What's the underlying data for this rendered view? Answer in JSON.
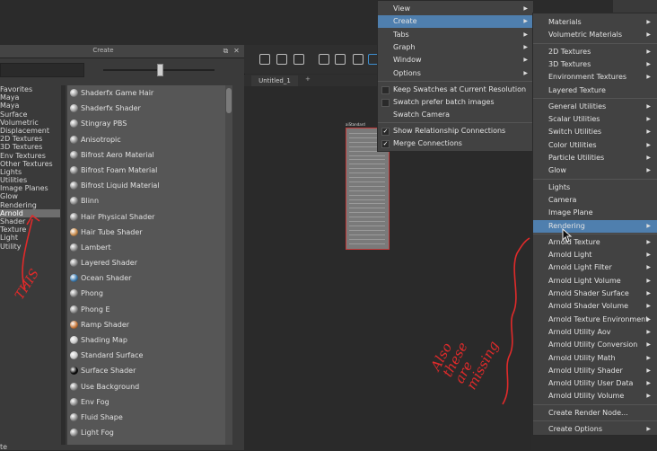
{
  "create_panel": {
    "title": "Create",
    "categories": [
      "Favorites",
      "Maya",
      "Maya",
      "Surface",
      "Volumetric",
      "Displacement",
      "2D Textures",
      "3D Textures",
      "Env Textures",
      "Other Textures",
      "Lights",
      "Utilities",
      "Image Planes",
      "Glow",
      "Rendering",
      "Arnold",
      "Shader",
      "Texture",
      "Light",
      "Utility"
    ],
    "selected_category": "Arnold",
    "nodes": [
      {
        "label": "Shaderfx Game Hair",
        "icon": "gray-sphere-icon",
        "color": "#9a9a9a"
      },
      {
        "label": "Shaderfx Shader",
        "icon": "gray-sphere-icon",
        "color": "#9a9a9a"
      },
      {
        "label": "Stingray PBS",
        "icon": "gray-sphere-icon",
        "color": "#9a9a9a"
      },
      {
        "label": "Anisotropic",
        "icon": "gray-sphere-icon",
        "color": "#8a8a8a"
      },
      {
        "label": "Bifrost Aero Material",
        "icon": "gray-sphere-icon",
        "color": "#8a8a8a"
      },
      {
        "label": "Bifrost Foam Material",
        "icon": "gray-sphere-icon",
        "color": "#8a8a8a"
      },
      {
        "label": "Bifrost Liquid Material",
        "icon": "gray-sphere-icon",
        "color": "#8a8a8a"
      },
      {
        "label": "Blinn",
        "icon": "gray-sphere-icon",
        "color": "#8a8a8a"
      },
      {
        "label": "Hair Physical Shader",
        "icon": "gray-sphere-icon",
        "color": "#8a8a8a"
      },
      {
        "label": "Hair Tube Shader",
        "icon": "hair-tube-icon",
        "color": "#c88a4a"
      },
      {
        "label": "Lambert",
        "icon": "gray-sphere-icon",
        "color": "#8a8a8a"
      },
      {
        "label": "Layered Shader",
        "icon": "gray-sphere-icon",
        "color": "#8a8a8a"
      },
      {
        "label": "Ocean Shader",
        "icon": "blue-sphere-icon",
        "color": "#3a7ab0"
      },
      {
        "label": "Phong",
        "icon": "gray-sphere-icon",
        "color": "#8a8a8a"
      },
      {
        "label": "Phong E",
        "icon": "gray-sphere-icon",
        "color": "#8a8a8a"
      },
      {
        "label": "Ramp Shader",
        "icon": "ramp-icon",
        "color": "#c8783a"
      },
      {
        "label": "Shading Map",
        "icon": "white-sphere-icon",
        "color": "#c8c8c8"
      },
      {
        "label": "Standard Surface",
        "icon": "white-sphere-icon",
        "color": "#c8c8c8"
      },
      {
        "label": "Surface Shader",
        "icon": "black-sphere-icon",
        "color": "#050505"
      },
      {
        "label": "Use Background",
        "icon": "gray-sphere-icon",
        "color": "#8a8a8a"
      },
      {
        "label": "Env Fog",
        "icon": "fog-icon",
        "color": "#8a8a8a"
      },
      {
        "label": "Fluid Shape",
        "icon": "fluid-icon",
        "color": "#8a8a8a"
      },
      {
        "label": "Light Fog",
        "icon": "fog-icon",
        "color": "#8a8a8a"
      }
    ]
  },
  "editor": {
    "tab_label": "Untitled_1",
    "tab_add": "+",
    "node_title": "aiStandard"
  },
  "create_menu": {
    "items": [
      {
        "label": "View",
        "arrow": true
      },
      {
        "label": "Create",
        "arrow": true,
        "highlight": true
      },
      {
        "label": "Tabs",
        "arrow": true
      },
      {
        "label": "Graph",
        "arrow": true
      },
      {
        "label": "Window",
        "arrow": true
      },
      {
        "label": "Options",
        "arrow": true
      }
    ],
    "checkboxes": [
      {
        "label": "Keep Swatches at Current Resolution",
        "checked": false
      },
      {
        "label": "Swatch prefer batch images",
        "checked": false
      },
      {
        "label": "Swatch Camera",
        "checked": false,
        "nobox": true
      },
      {
        "label": "Show Relationship Connections",
        "checked": true
      },
      {
        "label": "Merge Connections",
        "checked": true
      }
    ]
  },
  "sub_menu": {
    "items": [
      "Materials",
      "Volumetric Materials",
      "-",
      "2D Textures",
      "3D Textures",
      "Environment Textures",
      "Layered Texture",
      "-",
      "General Utilities",
      "Scalar Utilities",
      "Switch Utilities",
      "Color Utilities",
      "Particle Utilities",
      "Glow",
      "-",
      "Lights",
      "Camera",
      "Image Plane",
      "Rendering",
      "-",
      "Arnold Texture",
      "Arnold Light",
      "Arnold Light Filter",
      "Arnold Light Volume",
      "Arnold Shader Surface",
      "Arnold Shader Volume",
      "Arnold Texture Environment",
      "Arnold Utility Aov",
      "Arnold Utility Conversion",
      "Arnold Utility Math",
      "Arnold Utility Shader",
      "Arnold Utility User Data",
      "Arnold Utility Volume",
      "-",
      "Create Render Node...",
      "-",
      "Create Options"
    ],
    "with_arrow": [
      "Materials",
      "Volumetric Materials",
      "2D Textures",
      "3D Textures",
      "Environment Textures",
      "General Utilities",
      "Scalar Utilities",
      "Switch Utilities",
      "Color Utilities",
      "Particle Utilities",
      "Glow",
      "Rendering",
      "Arnold Texture",
      "Arnold Light",
      "Arnold Light Filter",
      "Arnold Light Volume",
      "Arnold Shader Surface",
      "Arnold Shader Volume",
      "Arnold Texture Environment",
      "Arnold Utility Aov",
      "Arnold Utility Conversion",
      "Arnold Utility Math",
      "Arnold Utility Shader",
      "Arnold Utility User Data",
      "Arnold Utility Volume",
      "Create Options"
    ],
    "highlight": "Rendering"
  },
  "annotations": {
    "this": "THIS",
    "also": [
      "Also",
      "these",
      "are",
      "missing"
    ]
  },
  "bottom": {
    "label": "te"
  },
  "colors": {
    "accent": "#4f7fae",
    "annotation": "#e02a2a"
  }
}
